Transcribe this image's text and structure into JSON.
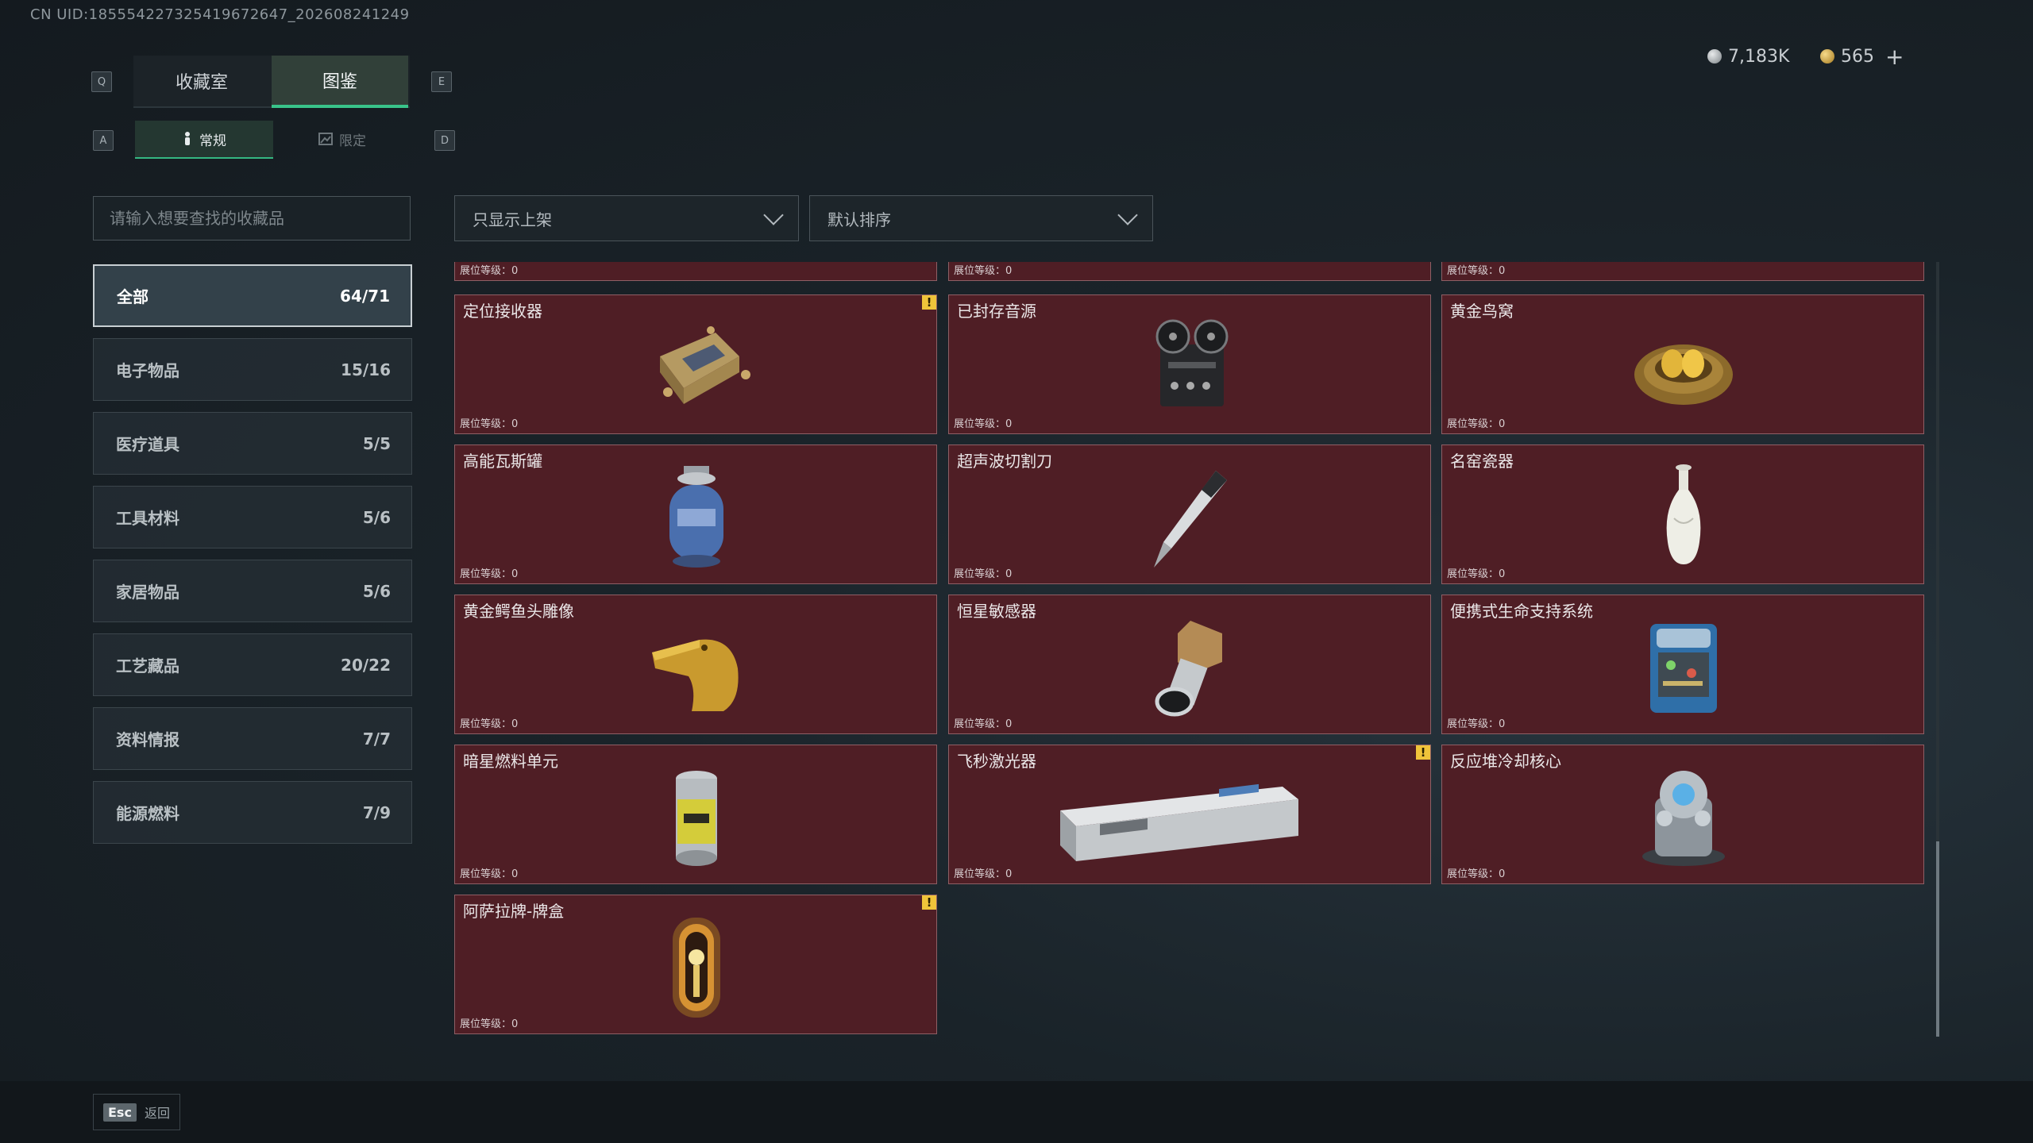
{
  "uid_text": "CN UID:185554227325419672647_202608241249",
  "key_hints": {
    "q": "Q",
    "e": "E",
    "a": "A",
    "d": "D"
  },
  "top_tabs": [
    {
      "label": "收藏室",
      "active": false
    },
    {
      "label": "图鉴",
      "active": true
    }
  ],
  "sub_tabs": [
    {
      "label": "常规",
      "active": true,
      "icon": "figure-icon"
    },
    {
      "label": "限定",
      "active": false,
      "icon": "image-icon"
    }
  ],
  "currency": {
    "silver": "7,183K",
    "gold": "565",
    "add_label": "+"
  },
  "search": {
    "placeholder": "请输入想要查找的收藏品"
  },
  "categories": [
    {
      "label": "全部",
      "count": "64/71",
      "active": true
    },
    {
      "label": "电子物品",
      "count": "15/16"
    },
    {
      "label": "医疗道具",
      "count": "5/5"
    },
    {
      "label": "工具材料",
      "count": "5/6"
    },
    {
      "label": "家居物品",
      "count": "5/6"
    },
    {
      "label": "工艺藏品",
      "count": "20/22"
    },
    {
      "label": "资料情报",
      "count": "7/7"
    },
    {
      "label": "能源燃料",
      "count": "7/9"
    }
  ],
  "filters": {
    "availability": "只显示上架",
    "sort": "默认排序"
  },
  "level_label": "展位等级：0",
  "items": [
    {
      "name": "",
      "icon": "item-icon",
      "warning": false
    },
    {
      "name": "",
      "icon": "item-icon",
      "warning": false
    },
    {
      "name": "",
      "icon": "item-icon",
      "warning": false
    },
    {
      "name": "定位接收器",
      "icon": "receiver-icon",
      "warning": true
    },
    {
      "name": "已封存音源",
      "icon": "tape-recorder-icon",
      "warning": false
    },
    {
      "name": "黄金鸟窝",
      "icon": "golden-nest-icon",
      "warning": false
    },
    {
      "name": "高能瓦斯罐",
      "icon": "gas-canister-icon",
      "warning": false
    },
    {
      "name": "超声波切割刀",
      "icon": "ultrasonic-knife-icon",
      "warning": false
    },
    {
      "name": "名窑瓷器",
      "icon": "porcelain-vase-icon",
      "warning": false
    },
    {
      "name": "黄金鳄鱼头雕像",
      "icon": "crocodile-statue-icon",
      "warning": false
    },
    {
      "name": "恒星敏感器",
      "icon": "star-sensor-icon",
      "warning": false
    },
    {
      "name": "便携式生命支持系统",
      "icon": "life-support-icon",
      "warning": false
    },
    {
      "name": "暗星燃料单元",
      "icon": "fuel-cell-icon",
      "warning": false
    },
    {
      "name": "飞秒激光器",
      "icon": "laser-device-icon",
      "warning": true
    },
    {
      "name": "反应堆冷却核心",
      "icon": "reactor-core-icon",
      "warning": false
    },
    {
      "name": "阿萨拉牌-牌盒",
      "icon": "card-box-icon",
      "warning": true
    }
  ],
  "warning_mark": "!",
  "footer": {
    "esc_key": "Esc",
    "back_label": "返回"
  },
  "colors": {
    "card_bg": "#4f1e25",
    "card_border": "#8e5f65",
    "accent_green": "#39c48a",
    "warning": "#f0c43a"
  }
}
